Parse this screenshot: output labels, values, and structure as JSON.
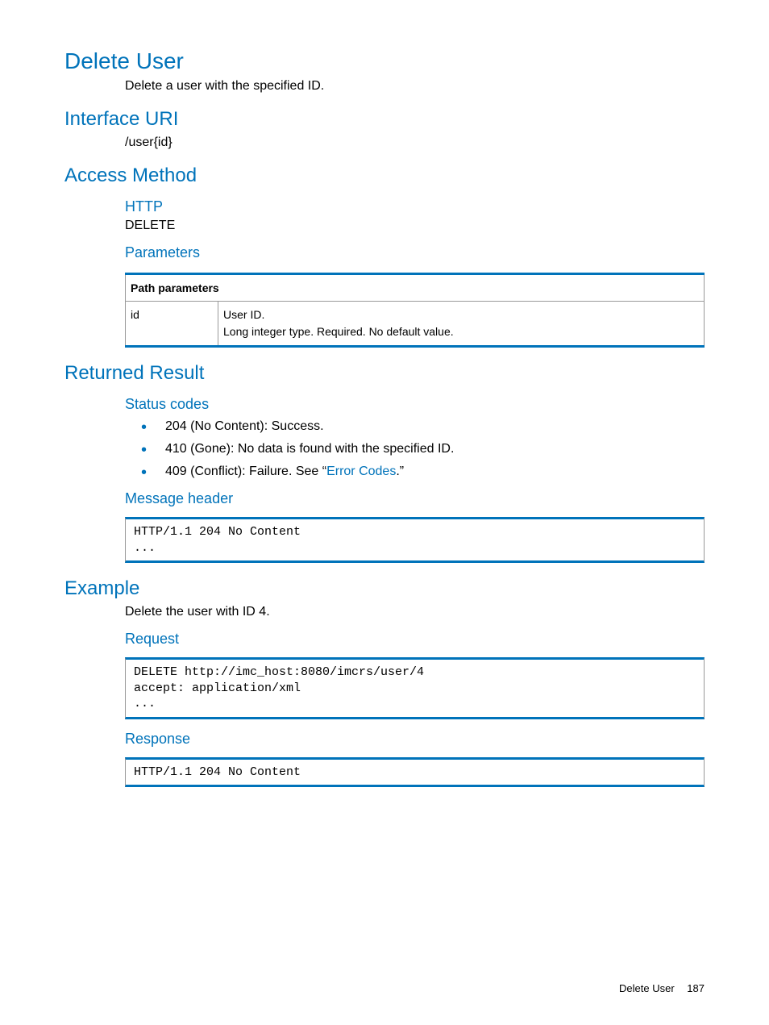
{
  "title": "Delete User",
  "intro": "Delete a user with the specified ID.",
  "interface_uri": {
    "heading": "Interface URI",
    "value": "/user{id}"
  },
  "access_method": {
    "heading": "Access Method",
    "http_heading": "HTTP",
    "http_value": "DELETE",
    "params_heading": "Parameters",
    "table_header": "Path parameters",
    "param_name": "id",
    "param_desc": "User ID.\nLong integer type. Required. No default value."
  },
  "returned_result": {
    "heading": "Returned Result",
    "status_heading": "Status codes",
    "status_items": [
      "204 (No Content): Success.",
      "410 (Gone): No data is found with the specified ID.",
      "409 (Conflict): Failure. See “"
    ],
    "error_codes_link": "Error Codes",
    "status_item_suffix": ".”",
    "message_header_heading": "Message header",
    "message_header_code": "HTTP/1.1 204 No Content\n..."
  },
  "example": {
    "heading": "Example",
    "intro": "Delete the user with ID 4.",
    "request_heading": "Request",
    "request_code": "DELETE http://imc_host:8080/imcrs/user/4\naccept: application/xml\n...",
    "response_heading": "Response",
    "response_code": "HTTP/1.1 204 No Content"
  },
  "footer": {
    "section": "Delete User",
    "page": "187"
  }
}
